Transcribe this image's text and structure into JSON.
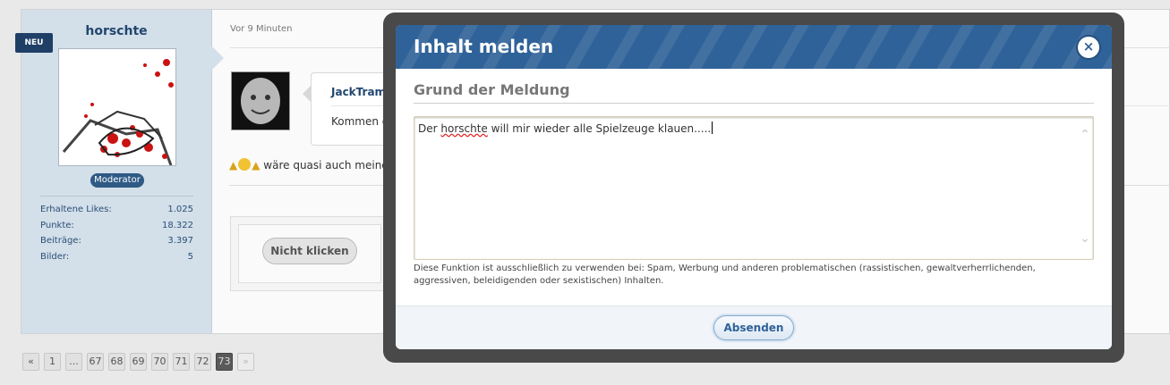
{
  "post": {
    "username": "horschte",
    "new_badge": "NEU",
    "role": "Moderator",
    "stats": [
      {
        "label": "Erhaltene Likes:",
        "value": "1.025"
      },
      {
        "label": "Punkte:",
        "value": "18.322"
      },
      {
        "label": "Beiträge:",
        "value": "3.397"
      },
      {
        "label": "Bilder:",
        "value": "5"
      }
    ],
    "time": "Vor 9 Minuten",
    "quote_author": "JackTramiel",
    "quote_text": "Kommen die",
    "emoji_text": "wäre quasi auch meine F",
    "button_label": "Nicht klicken"
  },
  "pagination": {
    "prev": "«",
    "pages": [
      "1",
      "...",
      "67",
      "68",
      "69",
      "70",
      "71",
      "72",
      "73"
    ],
    "current": "73",
    "next": "»"
  },
  "dialog": {
    "title": "Inhalt melden",
    "close_icon": "×",
    "section_title": "Grund der Meldung",
    "report_text_pre": "Der ",
    "report_text_misspelled": "horschte",
    "report_text_post": " will mir wieder alle Spielzeuge klauen.....",
    "hint": "Diese Funktion ist ausschließlich zu verwenden bei: Spam, Werbung und anderen problematischen (rassistischen, gewaltverherrlichenden, aggressiven, beleidigenden oder sexistischen) Inhalten.",
    "submit_label": "Absenden"
  },
  "colors": {
    "header_blue": "#2f6298",
    "sidebar": "#d3dfe9",
    "overlay": "#494949"
  }
}
